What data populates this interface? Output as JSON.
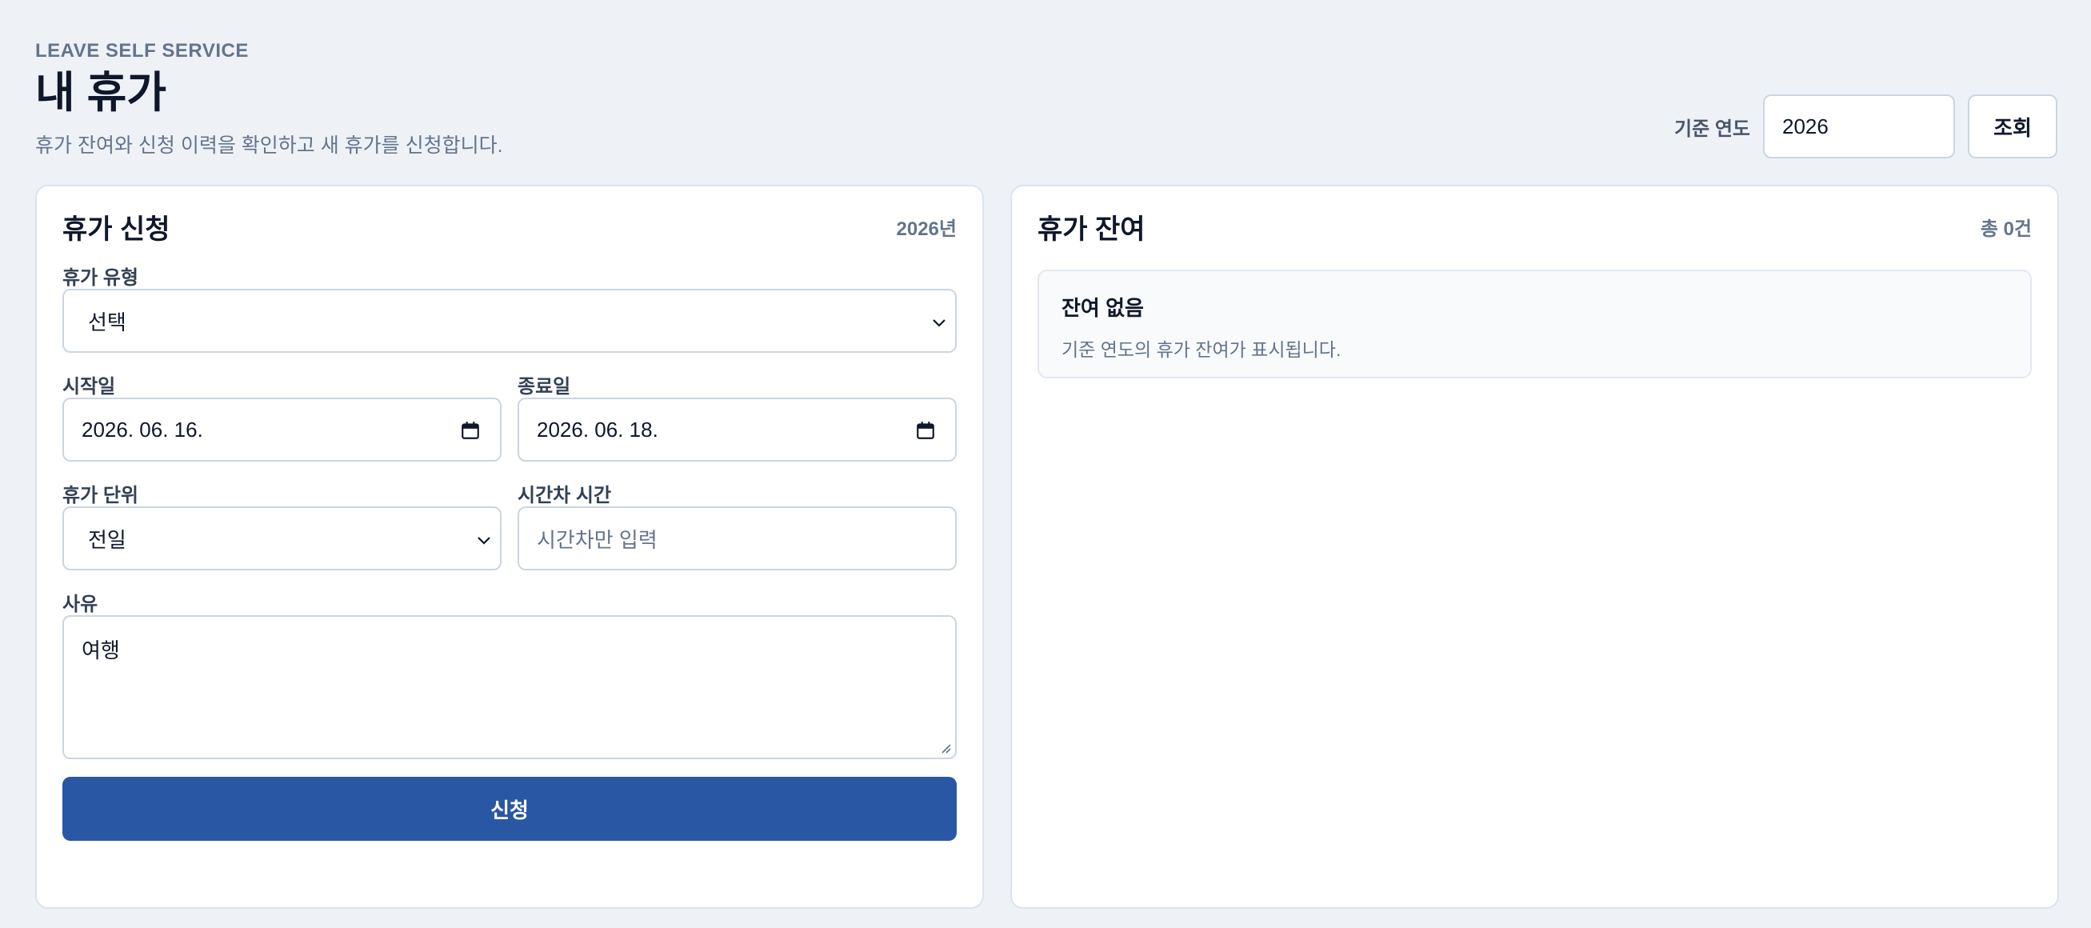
{
  "header": {
    "eyebrow": "LEAVE SELF SERVICE",
    "title": "내 휴가",
    "subtitle": "휴가 잔여와 신청 이력을 확인하고 새 휴가를 신청합니다."
  },
  "filter": {
    "label": "기준 연도",
    "year_value": "2026",
    "query_label": "조회"
  },
  "request_card": {
    "title": "휴가 신청",
    "year_badge": "2026년",
    "leave_type": {
      "label": "휴가 유형",
      "value": "선택"
    },
    "start_date": {
      "label": "시작일",
      "value": "2026. 06. 16."
    },
    "end_date": {
      "label": "종료일",
      "value": "2026. 06. 18."
    },
    "unit": {
      "label": "휴가 단위",
      "value": "전일"
    },
    "hourly": {
      "label": "시간차 시간",
      "placeholder": "시간차만 입력"
    },
    "reason": {
      "label": "사유",
      "value": "여행"
    },
    "submit_label": "신청"
  },
  "balance_card": {
    "title": "휴가 잔여",
    "count": "총 0건",
    "empty_title": "잔여 없음",
    "empty_desc": "기준 연도의 휴가 잔여가 표시됩니다."
  },
  "colors": {
    "primary": "#2957a4",
    "background": "#eef2f7",
    "border": "#cbd5e1"
  }
}
